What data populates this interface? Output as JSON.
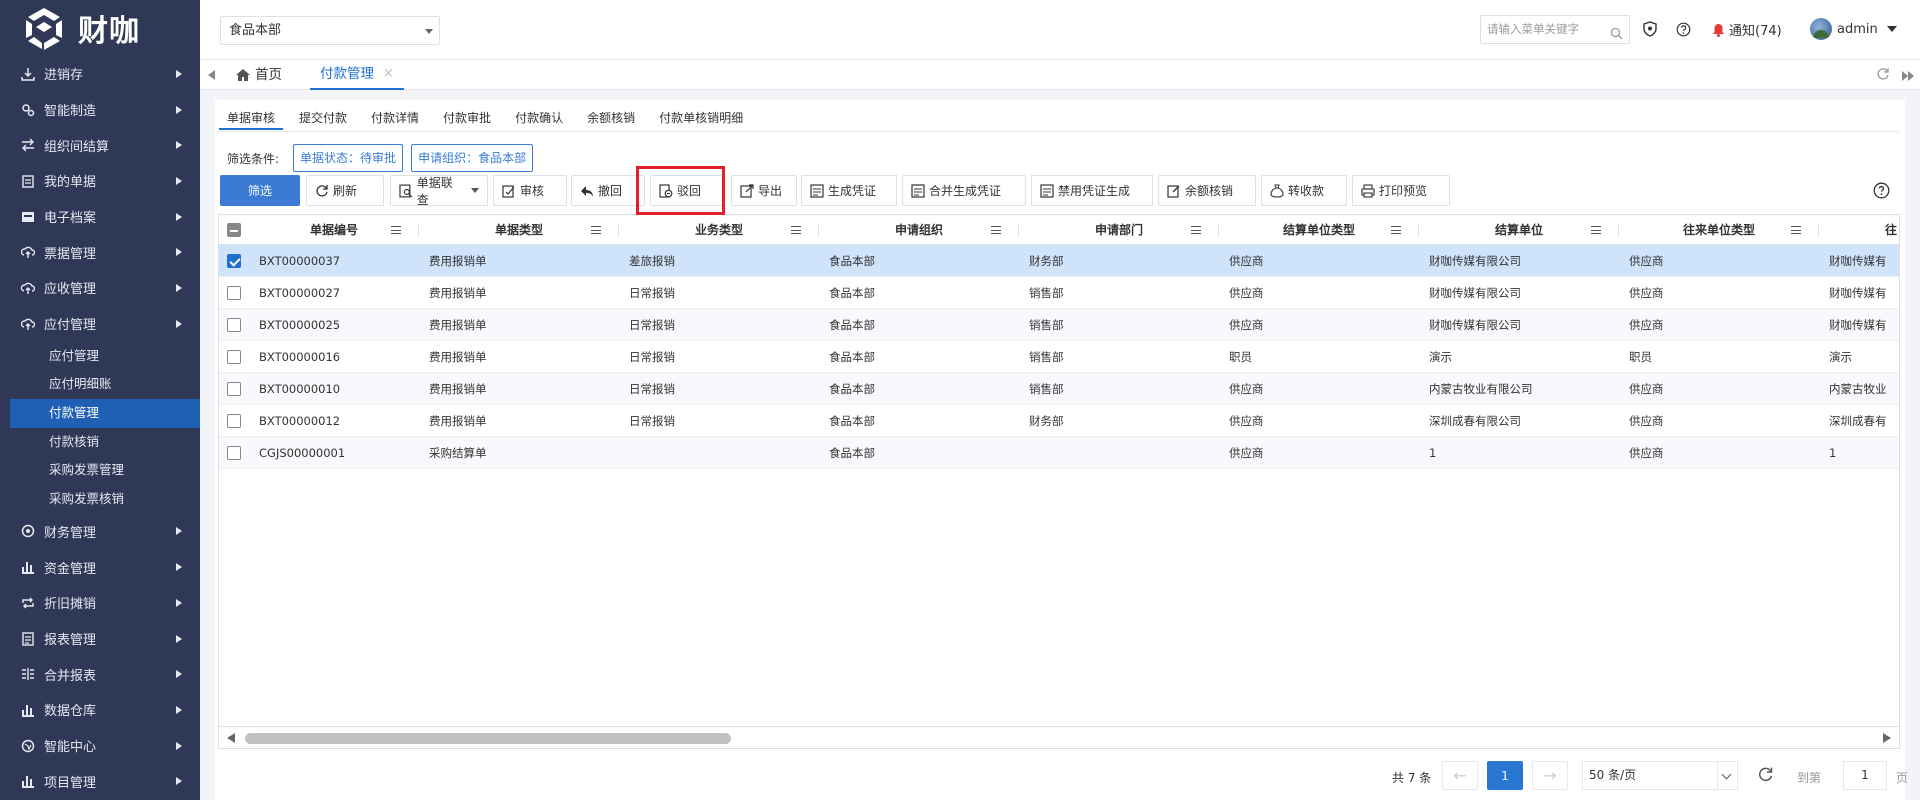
{
  "brand": {
    "name": "财咖"
  },
  "topbar": {
    "org": "食品本部",
    "search_placeholder": "请输入菜单关键字",
    "notice": "通知(74)",
    "user": "admin"
  },
  "sidebar": {
    "items": [
      {
        "label": "进销存",
        "icon": "download-icon"
      },
      {
        "label": "智能制造",
        "icon": "gears-icon"
      },
      {
        "label": "组织间结算",
        "icon": "exchange-icon"
      },
      {
        "label": "我的单据",
        "icon": "clipboard-icon"
      },
      {
        "label": "电子档案",
        "icon": "archive-icon"
      },
      {
        "label": "票据管理",
        "icon": "cloud-up-icon"
      },
      {
        "label": "应收管理",
        "icon": "cloud-up-icon"
      },
      {
        "label": "应付管理",
        "icon": "cloud-up-icon"
      }
    ],
    "sub": [
      "应付管理",
      "应付明细账",
      "付款管理",
      "付款核销",
      "采购发票管理",
      "采购发票核销"
    ],
    "items2": [
      {
        "label": "财务管理",
        "icon": "finance-icon"
      },
      {
        "label": "资金管理",
        "icon": "bar-chart-icon"
      },
      {
        "label": "折旧摊销",
        "icon": "repeat-icon"
      },
      {
        "label": "报表管理",
        "icon": "report-icon"
      },
      {
        "label": "合并报表",
        "icon": "merge-icon"
      },
      {
        "label": "数据仓库",
        "icon": "bar-chart-icon"
      },
      {
        "label": "智能中心",
        "icon": "globe-icon"
      },
      {
        "label": "项目管理",
        "icon": "bar-chart-icon"
      }
    ]
  },
  "tabs": {
    "home": "首页",
    "current": "付款管理",
    "close": "×"
  },
  "subtabs": [
    "单据审核",
    "提交付款",
    "付款详情",
    "付款审批",
    "付款确认",
    "余额核销",
    "付款单核销明细"
  ],
  "filter": {
    "label": "筛选条件:",
    "chips": [
      "单据状态：待审批",
      "申请组织：食品本部"
    ]
  },
  "toolbar": {
    "filter": "筛选",
    "refresh": "刷新",
    "linked": "单据联查",
    "audit": "审核",
    "withdraw": "撤回",
    "reject": "驳回",
    "export": "导出",
    "gen_voucher": "生成凭证",
    "merge_voucher": "合并生成凭证",
    "disable_voucher": "禁用凭证生成",
    "balance_writeoff": "余额核销",
    "transfer": "转收款",
    "print_preview": "打印预览"
  },
  "table": {
    "columns": [
      "单据编号",
      "单据类型",
      "业务类型",
      "申请组织",
      "申请部门",
      "结算单位类型",
      "结算单位",
      "往来单位类型",
      "往"
    ],
    "rows": [
      {
        "checked": true,
        "cells": [
          "BXT00000037",
          "费用报销单",
          "差旅报销",
          "食品本部",
          "财务部",
          "供应商",
          "财咖传媒有限公司",
          "供应商",
          "财咖传媒有"
        ]
      },
      {
        "checked": false,
        "cells": [
          "BXT00000027",
          "费用报销单",
          "日常报销",
          "食品本部",
          "销售部",
          "供应商",
          "财咖传媒有限公司",
          "供应商",
          "财咖传媒有"
        ]
      },
      {
        "checked": false,
        "cells": [
          "BXT00000025",
          "费用报销单",
          "日常报销",
          "食品本部",
          "销售部",
          "供应商",
          "财咖传媒有限公司",
          "供应商",
          "财咖传媒有"
        ]
      },
      {
        "checked": false,
        "cells": [
          "BXT00000016",
          "费用报销单",
          "日常报销",
          "食品本部",
          "销售部",
          "职员",
          "演示",
          "职员",
          "演示"
        ]
      },
      {
        "checked": false,
        "cells": [
          "BXT00000010",
          "费用报销单",
          "日常报销",
          "食品本部",
          "销售部",
          "供应商",
          "内蒙古牧业有限公司",
          "供应商",
          "内蒙古牧业"
        ]
      },
      {
        "checked": false,
        "cells": [
          "BXT00000012",
          "费用报销单",
          "日常报销",
          "食品本部",
          "财务部",
          "供应商",
          "深圳成春有限公司",
          "供应商",
          "深圳成春有"
        ]
      },
      {
        "checked": false,
        "cells": [
          "CGJS00000001",
          "采购结算单",
          "",
          "食品本部",
          "",
          "供应商",
          "1",
          "供应商",
          "1"
        ]
      }
    ]
  },
  "pager": {
    "total": "共 7 条",
    "prev": "←",
    "page": "1",
    "next": "→",
    "size": "50 条/页",
    "goto": "到第",
    "goto_value": "1",
    "unit": "页"
  },
  "colors": {
    "sidebar": "#2f3856",
    "accent": "#1f6fd0",
    "selected_row": "#cfe3fa",
    "highlight": "#e0202a"
  }
}
